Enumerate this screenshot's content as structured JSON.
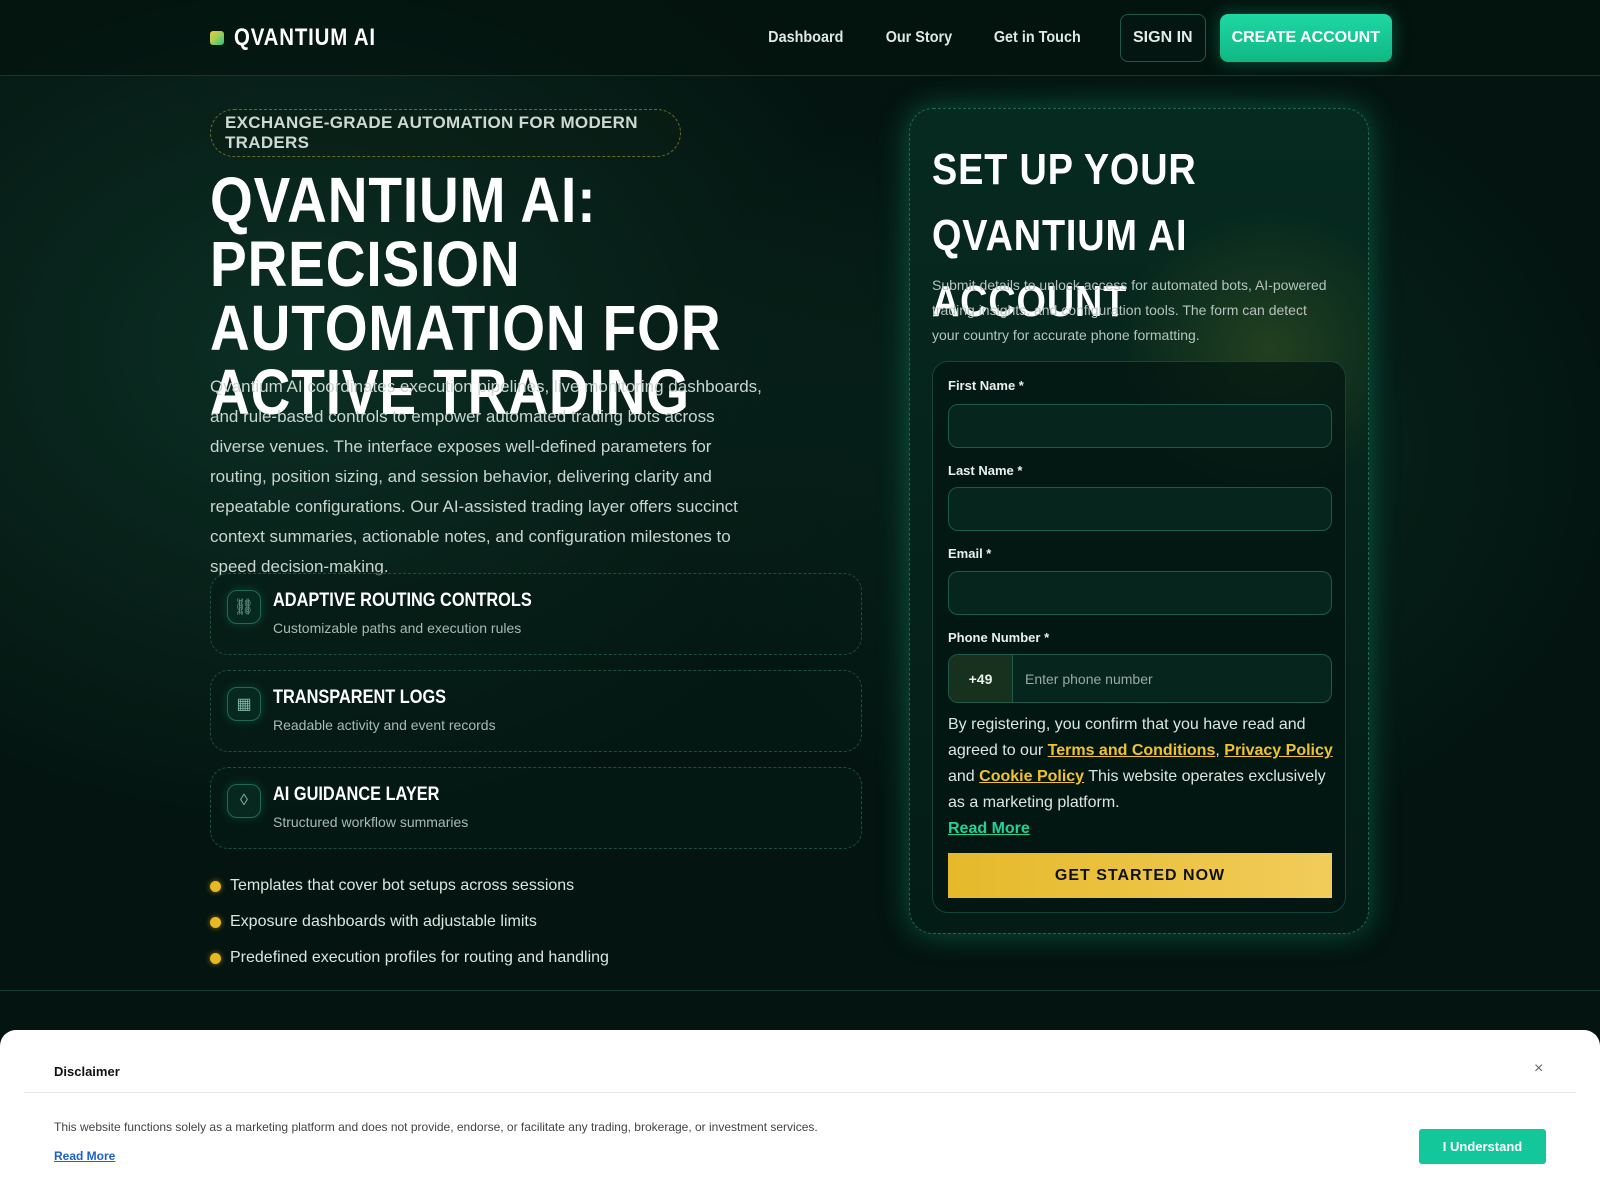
{
  "header": {
    "brand": "QVANTIUM AI",
    "nav": [
      "Dashboard",
      "Our Story",
      "Get in Touch"
    ],
    "sign_in": "SIGN IN",
    "create_account": "CREATE ACCOUNT"
  },
  "hero": {
    "pill": "EXCHANGE-GRADE AUTOMATION FOR MODERN TRADERS",
    "title": "QVANTIUM AI: PRECISION AUTOMATION FOR ACTIVE TRADING",
    "description": "Qvantium AI coordinates execution pipelines, live monitoring dashboards, and rule-based controls to empower automated trading bots across diverse venues. The interface exposes well-defined parameters for routing, position sizing, and session behavior, delivering clarity and repeatable configurations. Our AI-assisted trading layer offers succinct context summaries, actionable notes, and configuration milestones to speed decision-making.",
    "features": [
      {
        "icon": "route-icon",
        "glyph": "⛓",
        "title": "ADAPTIVE ROUTING CONTROLS",
        "subtitle": "Customizable paths and execution rules"
      },
      {
        "icon": "grid-log-icon",
        "glyph": "▦",
        "title": "TRANSPARENT LOGS",
        "subtitle": "Readable activity and event records"
      },
      {
        "icon": "diamond-icon",
        "glyph": "◊",
        "title": "AI GUIDANCE LAYER",
        "subtitle": "Structured workflow summaries"
      }
    ],
    "bullets": [
      "Templates that cover bot setups across sessions",
      "Exposure dashboards with adjustable limits",
      "Predefined execution profiles for routing and handling"
    ]
  },
  "form": {
    "title": "SET UP YOUR QVANTIUM AI ACCOUNT",
    "description": "Submit details to unlock access for automated bots, AI-powered trading insights, and configuration tools. The form can detect your country for accurate phone formatting.",
    "first_name_label": "First Name *",
    "last_name_label": "Last Name *",
    "email_label": "Email *",
    "phone_label": "Phone Number *",
    "phone_code": "+49",
    "phone_placeholder": "Enter phone number",
    "consent_prefix": "By registering, you confirm that you have read and agreed to our",
    "terms": "Terms and Conditions",
    "comma": ",",
    "privacy": "Privacy Policy",
    "and": "and",
    "cookie": "Cookie Policy",
    "marketing_note": "This website operates exclusively as a marketing platform.",
    "read_more": "Read More",
    "submit": "GET STARTED NOW"
  },
  "disclaimer": {
    "title": "Disclaimer",
    "close": "×",
    "text": "This website functions solely as a marketing platform and does not provide, endorse, or facilitate any trading, brokerage, or investment services.",
    "read_more": "Read More",
    "button": "I Understand"
  },
  "colors": {
    "accent_green": "#14c79a",
    "accent_gold": "#e8b923",
    "background": "#041410"
  }
}
